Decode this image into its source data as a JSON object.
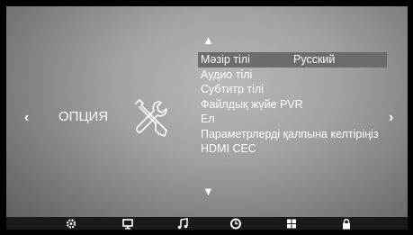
{
  "category": {
    "title": "ОПЦИЯ",
    "icon": "tools-icon"
  },
  "menu": {
    "items": [
      {
        "label": "Мәзір тілі",
        "value": "Русский",
        "selected": true
      },
      {
        "label": "Аудио тілі",
        "value": ""
      },
      {
        "label": "Субтитр тілі",
        "value": ""
      },
      {
        "label": "Файлдық жүйе PVR",
        "value": ""
      },
      {
        "label": "Ел",
        "value": ""
      },
      {
        "label": "Параметрлерді қалпына келтіріңіз",
        "value": ""
      },
      {
        "label": "HDMI CEC",
        "value": ""
      }
    ]
  },
  "tabs": [
    {
      "icon": "gear-icon"
    },
    {
      "icon": "monitor-icon"
    },
    {
      "icon": "music-note-icon"
    },
    {
      "icon": "clock-icon"
    },
    {
      "icon": "grid-icon"
    },
    {
      "icon": "lock-icon"
    }
  ]
}
